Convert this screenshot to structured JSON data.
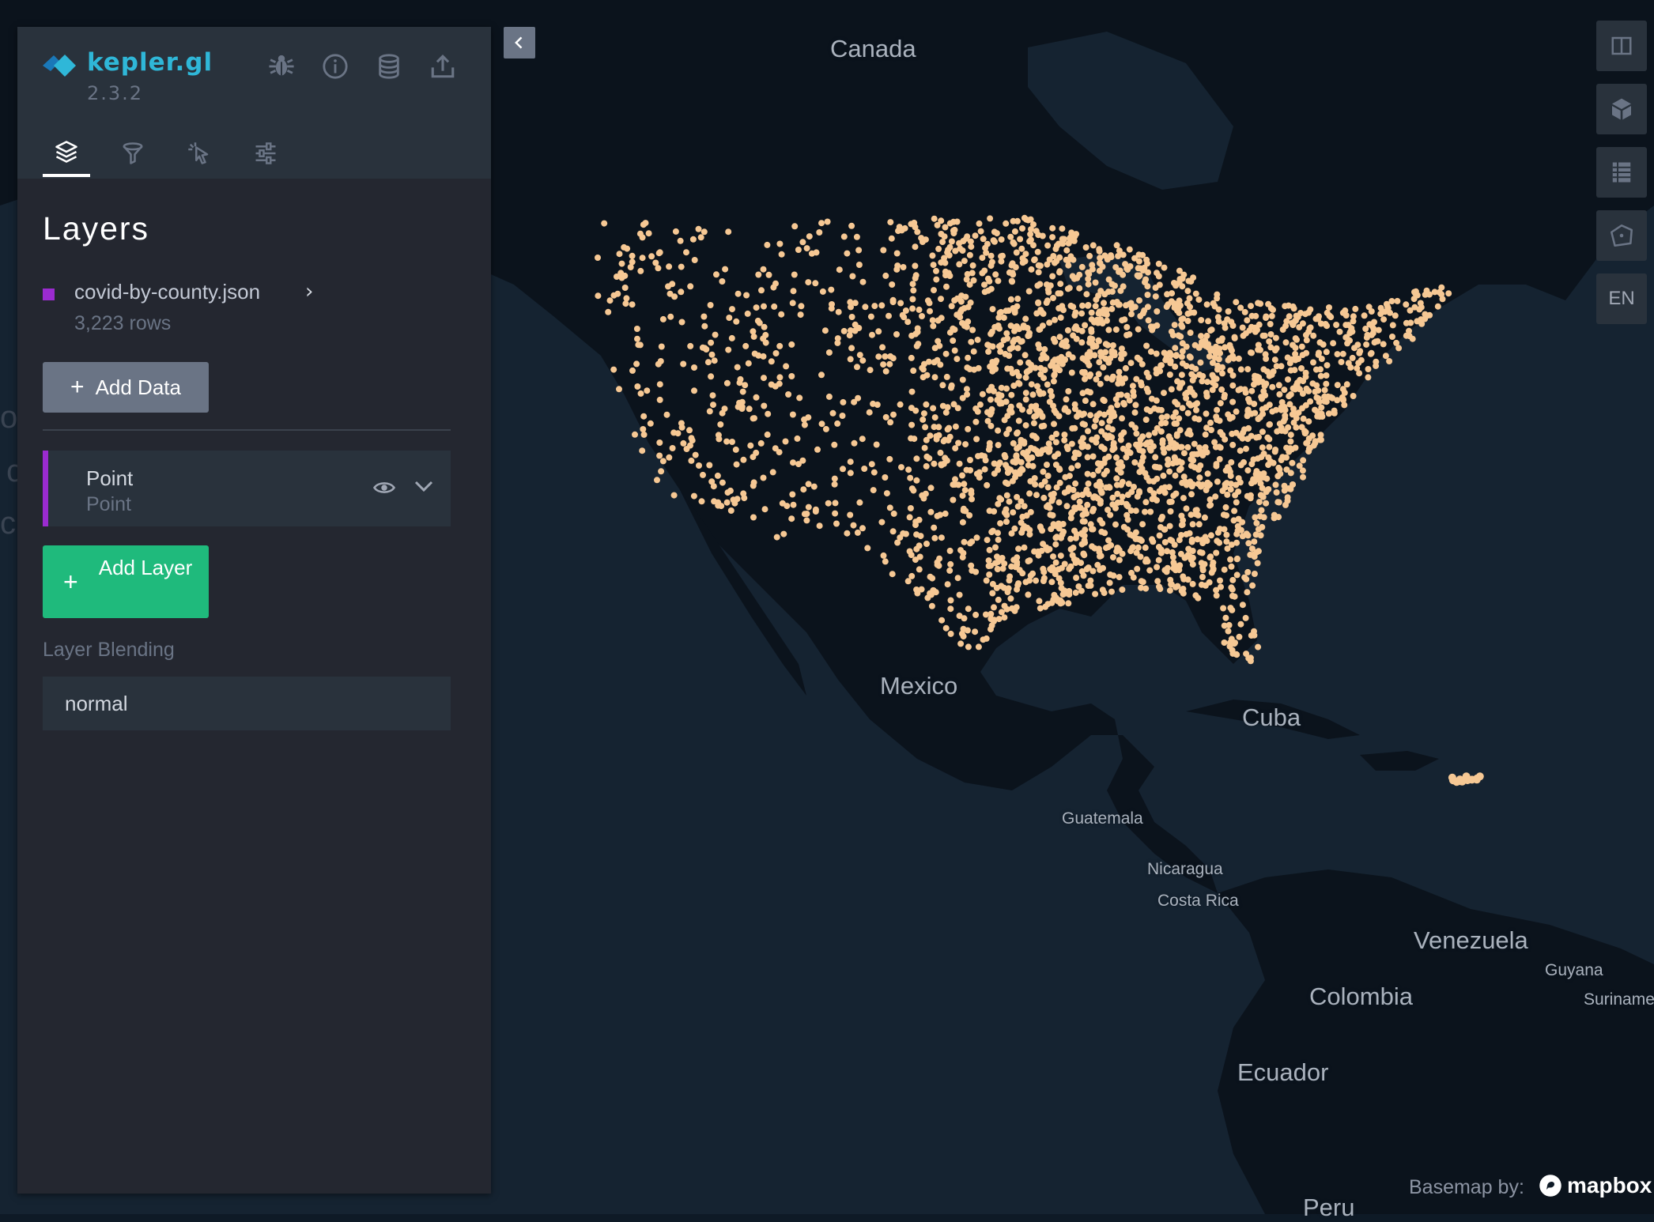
{
  "app": {
    "name": "kepler.gl",
    "version": "2.3.2",
    "accent_color": "#2fb7d8"
  },
  "header": {
    "icons": [
      "bug-icon",
      "info-icon",
      "database-icon",
      "share-icon"
    ],
    "tabs": [
      {
        "name": "layers-tab",
        "icon": "layers-icon",
        "active": true
      },
      {
        "name": "filters-tab",
        "icon": "filter-icon",
        "active": false
      },
      {
        "name": "interactions-tab",
        "icon": "cursor-icon",
        "active": false
      },
      {
        "name": "map-style-tab",
        "icon": "sliders-icon",
        "active": false
      }
    ]
  },
  "panel": {
    "title": "Layers",
    "dataset": {
      "name": "covid-by-county.json",
      "rows": "3,223 rows",
      "color": "#9b2bd0"
    },
    "add_data_label": "Add Data",
    "layer": {
      "title": "Point",
      "type": "Point"
    },
    "add_layer_label": "Add Layer",
    "blending_label": "Layer Blending",
    "blending_value": "normal"
  },
  "map": {
    "point_color": "#f6c894",
    "labels": {
      "canada": "Canada",
      "mexico": "Mexico",
      "cuba": "Cuba",
      "guatemala": "Guatemala",
      "nicaragua": "Nicaragua",
      "costa_rica": "Costa Rica",
      "venezuela": "Venezuela",
      "guyana": "Guyana",
      "suriname": "Suriname",
      "colombia": "Colombia",
      "ecuador": "Ecuador",
      "peru": "Peru"
    },
    "controls": {
      "locale": "EN"
    },
    "attribution": {
      "text": "Basemap by:",
      "brand": "mapbox"
    }
  }
}
